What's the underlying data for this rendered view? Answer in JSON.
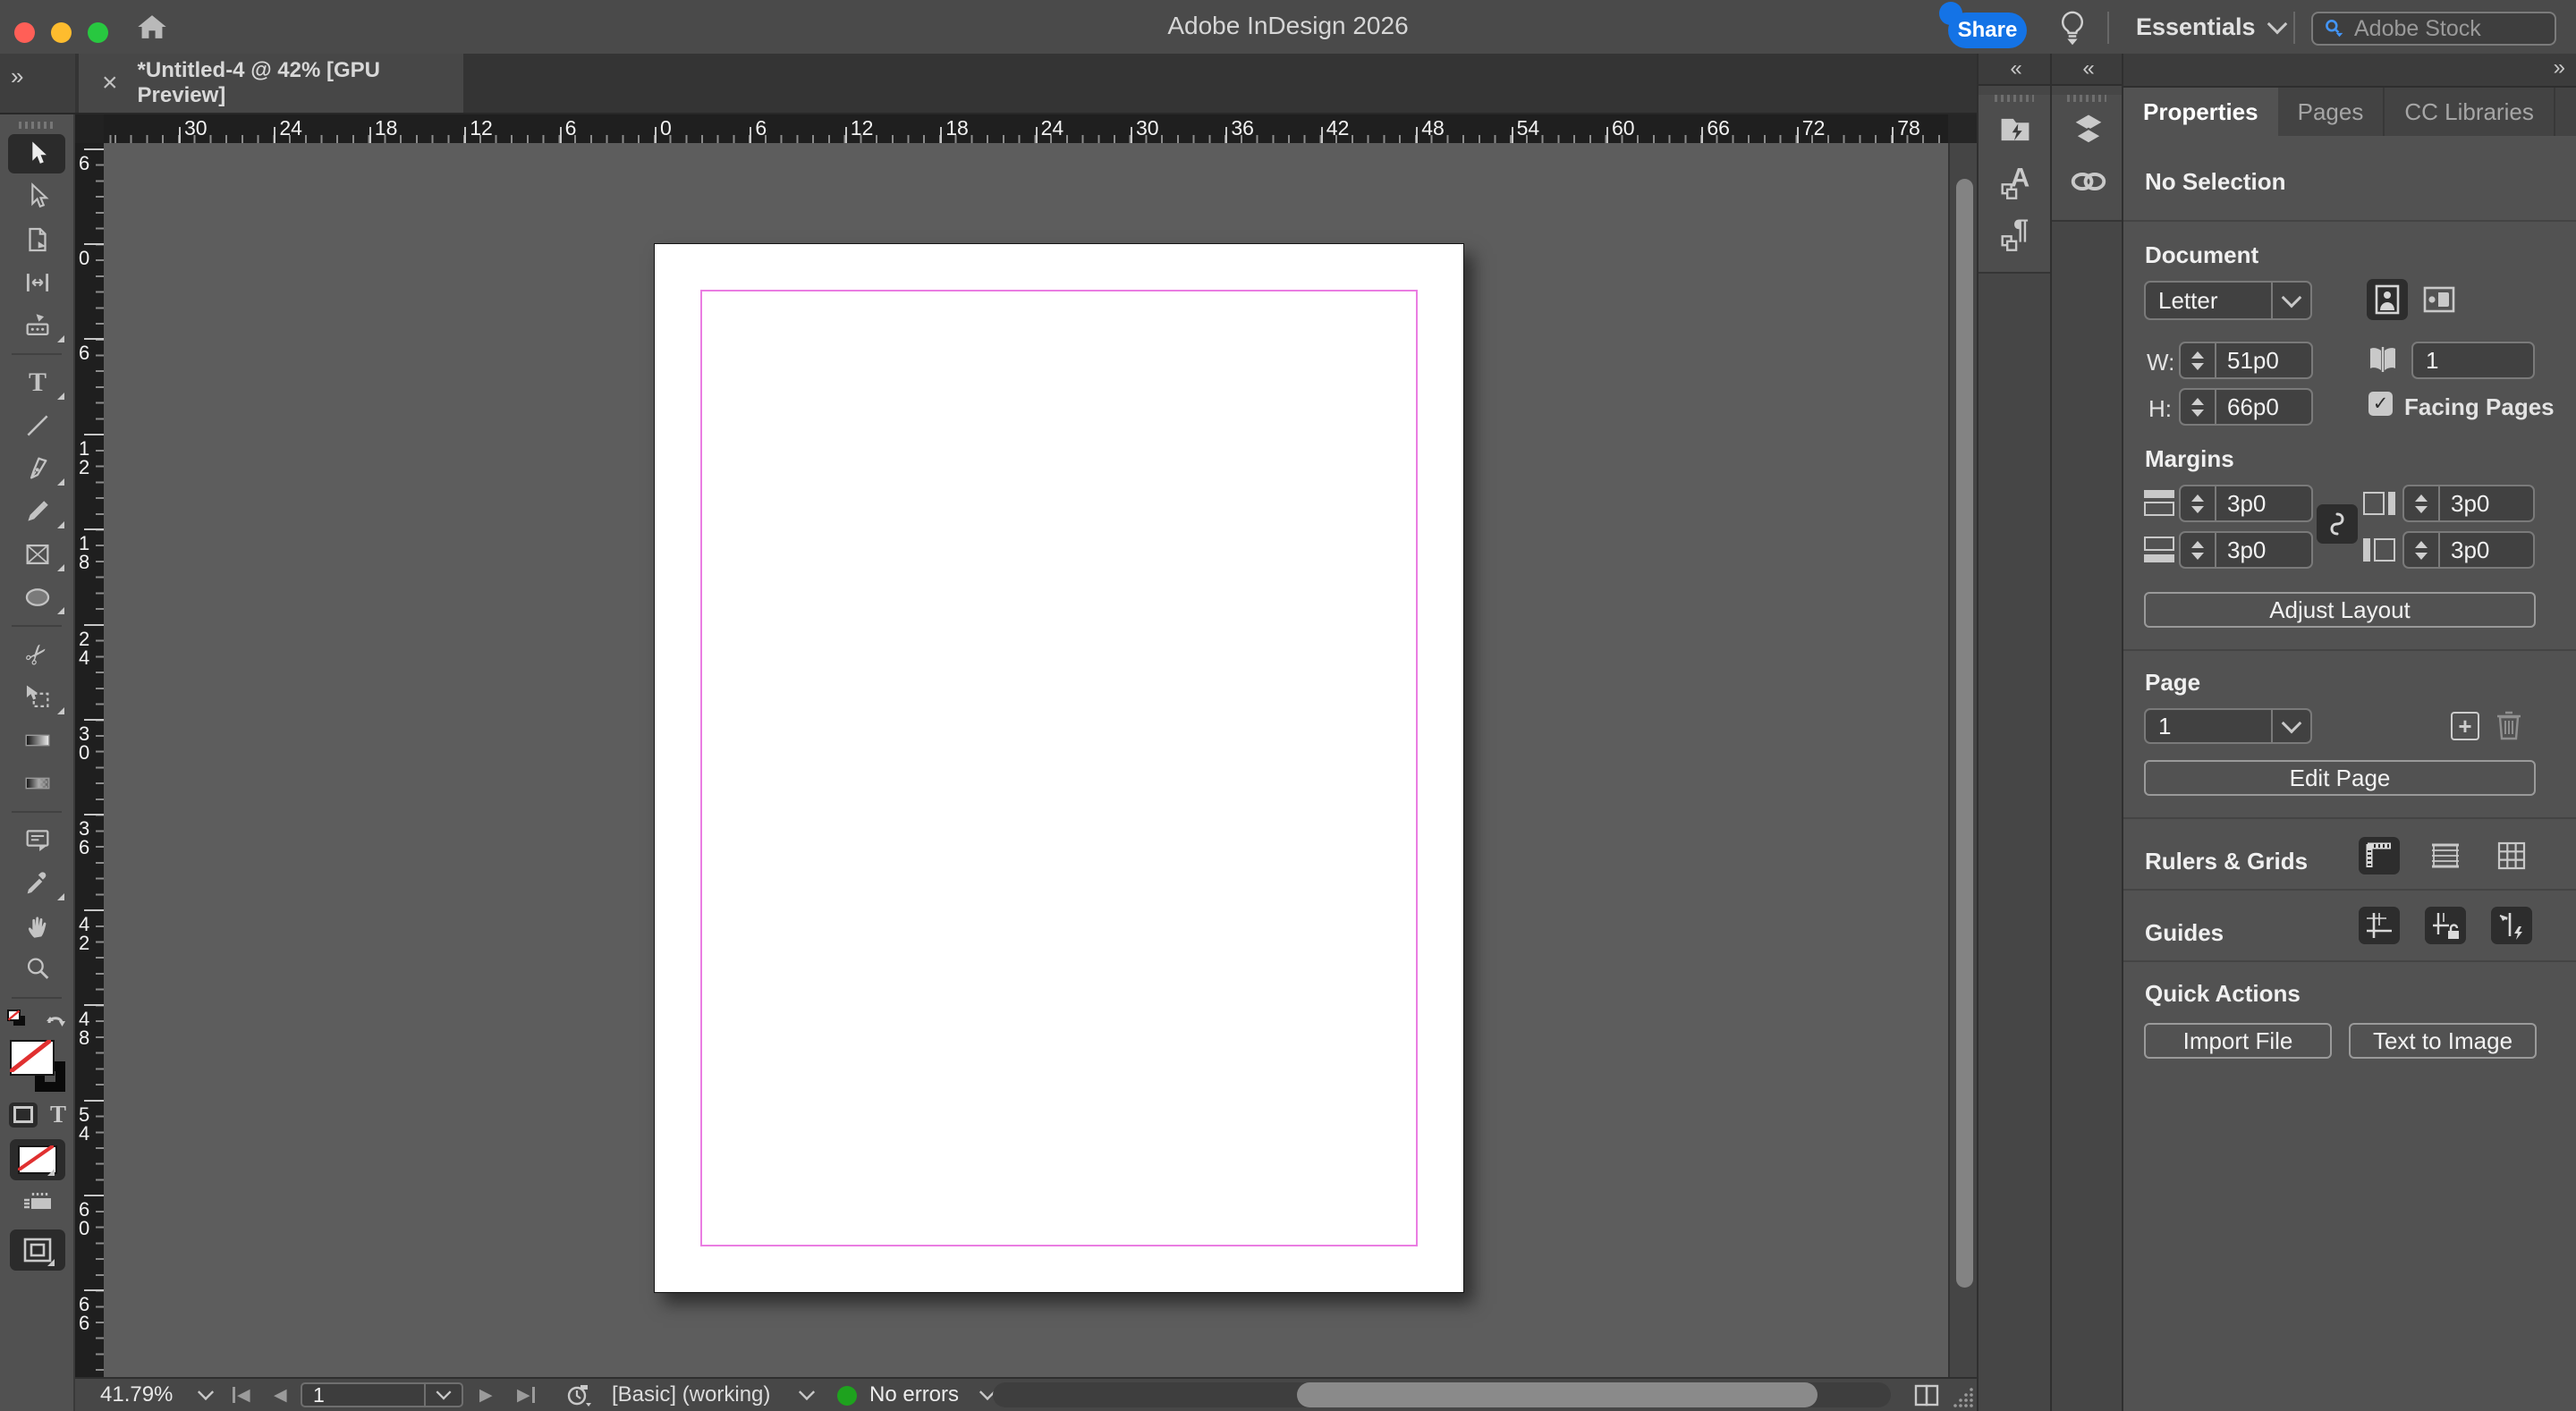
{
  "colors": {
    "accent_blue": "#1473e6",
    "ok_green": "#1ea21e",
    "margin_guide_pink": "#ea7de2",
    "ruler_bg": "#1f1f1f",
    "panel_bg": "#525252"
  },
  "titlebar": {
    "title": "Adobe InDesign 2026",
    "share_label": "Share",
    "workspace_label": "Essentials",
    "stock_placeholder": "Adobe Stock",
    "icons": [
      "home-icon",
      "lightbulb-icon",
      "search-icon",
      "chevron-down-icon"
    ]
  },
  "tabbar": {
    "document_tab": "*Untitled-4 @ 42% [GPU Preview]",
    "close_glyph": "×",
    "expand_panel_glyph": "»",
    "collapse_panel_glyph": "«"
  },
  "toolbar": {
    "tools": [
      {
        "name": "selection",
        "active": true
      },
      {
        "name": "direct-selection"
      },
      {
        "name": "page"
      },
      {
        "name": "gap"
      },
      {
        "name": "content-collector",
        "flyout": true
      },
      {
        "divider": true
      },
      {
        "name": "type",
        "flyout": true
      },
      {
        "name": "line"
      },
      {
        "name": "pen",
        "flyout": true
      },
      {
        "name": "pencil",
        "flyout": true
      },
      {
        "name": "rectangle-frame",
        "flyout": true
      },
      {
        "name": "ellipse",
        "flyout": true
      },
      {
        "divider": true
      },
      {
        "name": "scissors"
      },
      {
        "name": "free-transform",
        "flyout": true
      },
      {
        "name": "gradient-swatch"
      },
      {
        "name": "gradient-feather"
      },
      {
        "divider": true
      },
      {
        "name": "note"
      },
      {
        "name": "eyedropper",
        "flyout": true
      },
      {
        "name": "hand"
      },
      {
        "name": "zoom"
      },
      {
        "divider": true
      }
    ],
    "color_controls": [
      "default-fill-stroke-icon",
      "swap-fill-stroke-icon",
      "fill-none-swatch",
      "stroke-swatch",
      "formatting-affects-container-icon",
      "formatting-affects-text-icon",
      "apply-none-button",
      "view-options-icon",
      "screen-mode-button"
    ]
  },
  "rulers": {
    "horizontal_labels": [
      "30",
      "24",
      "18",
      "12",
      "6",
      "0",
      "6",
      "12",
      "18",
      "24",
      "30",
      "36",
      "42",
      "48",
      "54",
      "60",
      "66",
      "72",
      "78"
    ],
    "vertical_labels": [
      "6",
      "0",
      "6",
      "12",
      "18",
      "24",
      "30",
      "36",
      "42",
      "48",
      "54",
      "60",
      "66"
    ]
  },
  "panel_strips": [
    {
      "icons": [
        "cc-libraries",
        "character-styles",
        "paragraph-styles"
      ]
    },
    {
      "icons": [
        "layers",
        "links"
      ]
    }
  ],
  "properties_panel": {
    "tabs": [
      "Properties",
      "Pages",
      "CC Libraries"
    ],
    "active_tab": "Properties",
    "no_selection": "No Selection",
    "document": {
      "heading": "Document",
      "preset": "Letter",
      "w_label": "W:",
      "w_value": "51p0",
      "h_label": "H:",
      "h_value": "66p0",
      "pages_value": "1",
      "facing_label": "Facing Pages",
      "facing_checked": true,
      "icons": [
        "portrait-icon",
        "landscape-icon",
        "facing-pages-icon"
      ]
    },
    "margins": {
      "heading": "Margins",
      "top": "3p0",
      "bottom": "3p0",
      "outside": "3p0",
      "inside": "3p0",
      "adjust_button": "Adjust Layout",
      "icons": [
        "margin-top-icon",
        "margin-bottom-icon",
        "margin-outside-icon",
        "margin-inside-icon",
        "link-margins-icon"
      ]
    },
    "page": {
      "heading": "Page",
      "value": "1",
      "edit_button": "Edit Page",
      "icons": [
        "add-page-icon",
        "delete-page-icon"
      ]
    },
    "rulers_grids": {
      "heading": "Rulers & Grids",
      "icons": [
        "show-rulers-icon",
        "baseline-grid-icon",
        "document-grid-icon"
      ]
    },
    "guides": {
      "heading": "Guides",
      "icons": [
        "show-guides-icon",
        "lock-guides-icon",
        "smart-guides-icon"
      ]
    },
    "quick_actions": {
      "heading": "Quick Actions",
      "import_button": "Import File",
      "tti_button": "Text to Image"
    }
  },
  "statusbar": {
    "zoom": "41.79%",
    "page_value": "1",
    "preflight_profile": "[Basic] (working)",
    "error_status": "No errors",
    "icons": [
      "first-page-icon",
      "previous-page-icon",
      "next-page-icon",
      "last-page-icon",
      "preflight-icon",
      "spread-view-icon",
      "resize-grip-icon"
    ]
  }
}
